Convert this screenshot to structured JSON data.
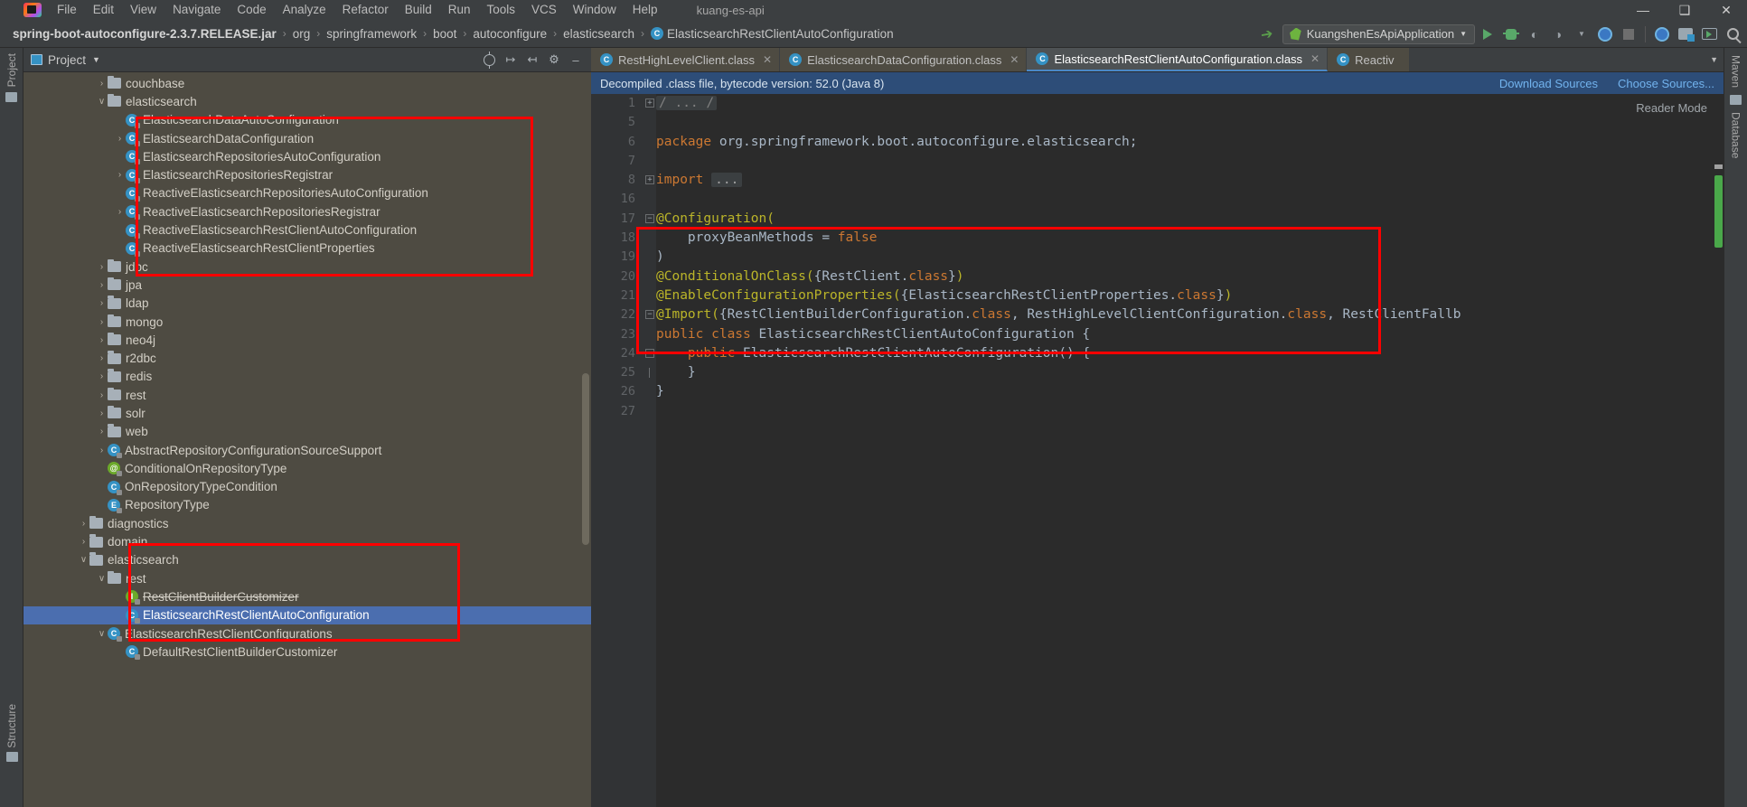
{
  "titlebar": {
    "menus": [
      "File",
      "Edit",
      "View",
      "Navigate",
      "Code",
      "Analyze",
      "Refactor",
      "Build",
      "Run",
      "Tools",
      "VCS",
      "Window",
      "Help"
    ],
    "project_name": "kuang-es-api",
    "window_buttons": [
      "—",
      "❑",
      "✕"
    ]
  },
  "navbar": {
    "breadcrumbs": [
      {
        "label": "spring-boot-autoconfigure-2.3.7.RELEASE.jar",
        "type": "jar"
      },
      {
        "label": "org",
        "type": "pkg"
      },
      {
        "label": "springframework",
        "type": "pkg"
      },
      {
        "label": "boot",
        "type": "pkg"
      },
      {
        "label": "autoconfigure",
        "type": "pkg"
      },
      {
        "label": "elasticsearch",
        "type": "pkg"
      },
      {
        "label": "ElasticsearchRestClientAutoConfiguration",
        "type": "class",
        "icon": "C"
      }
    ],
    "separator": "›",
    "run_config": "KuangshenEsApiApplication",
    "run_config_caret": "▼",
    "icons": [
      "hammer-icon",
      "run-icon",
      "debug-icon",
      "run-coverage-icon",
      "profiler-icon",
      "stop-icon",
      "updater-icon",
      "search-everywhere-icon"
    ]
  },
  "left_stripe": {
    "project_label": "Project",
    "structure_label": "Structure"
  },
  "right_stripe": {
    "maven_label": "Maven",
    "database_label": "Database"
  },
  "project_panel": {
    "title": "Project",
    "caret": "▼",
    "actions": [
      "locate-icon",
      "expand-all-icon",
      "collapse-all-icon",
      "settings-gear-icon",
      "hide-icon"
    ],
    "tree": [
      {
        "depth": 3,
        "arrow": "›",
        "kind": "folder",
        "label": "couchbase"
      },
      {
        "depth": 3,
        "arrow": "∨",
        "kind": "folder",
        "label": "elasticsearch"
      },
      {
        "depth": 4,
        "arrow": "",
        "kind": "class",
        "label": "ElasticsearchDataAutoConfiguration"
      },
      {
        "depth": 4,
        "arrow": "›",
        "kind": "class",
        "label": "ElasticsearchDataConfiguration"
      },
      {
        "depth": 4,
        "arrow": "",
        "kind": "class",
        "label": "ElasticsearchRepositoriesAutoConfiguration"
      },
      {
        "depth": 4,
        "arrow": "›",
        "kind": "class",
        "label": "ElasticsearchRepositoriesRegistrar"
      },
      {
        "depth": 4,
        "arrow": "",
        "kind": "class",
        "label": "ReactiveElasticsearchRepositoriesAutoConfiguration"
      },
      {
        "depth": 4,
        "arrow": "›",
        "kind": "class",
        "label": "ReactiveElasticsearchRepositoriesRegistrar"
      },
      {
        "depth": 4,
        "arrow": "",
        "kind": "class",
        "label": "ReactiveElasticsearchRestClientAutoConfiguration"
      },
      {
        "depth": 4,
        "arrow": "",
        "kind": "class",
        "label": "ReactiveElasticsearchRestClientProperties"
      },
      {
        "depth": 3,
        "arrow": "›",
        "kind": "folder",
        "label": "jdbc"
      },
      {
        "depth": 3,
        "arrow": "›",
        "kind": "folder",
        "label": "jpa"
      },
      {
        "depth": 3,
        "arrow": "›",
        "kind": "folder",
        "label": "ldap"
      },
      {
        "depth": 3,
        "arrow": "›",
        "kind": "folder",
        "label": "mongo"
      },
      {
        "depth": 3,
        "arrow": "›",
        "kind": "folder",
        "label": "neo4j"
      },
      {
        "depth": 3,
        "arrow": "›",
        "kind": "folder",
        "label": "r2dbc"
      },
      {
        "depth": 3,
        "arrow": "›",
        "kind": "folder",
        "label": "redis"
      },
      {
        "depth": 3,
        "arrow": "›",
        "kind": "folder",
        "label": "rest"
      },
      {
        "depth": 3,
        "arrow": "›",
        "kind": "folder",
        "label": "solr"
      },
      {
        "depth": 3,
        "arrow": "›",
        "kind": "folder",
        "label": "web"
      },
      {
        "depth": 3,
        "arrow": "›",
        "kind": "class",
        "label": "AbstractRepositoryConfigurationSourceSupport"
      },
      {
        "depth": 3,
        "arrow": "",
        "kind": "annotation",
        "label": "ConditionalOnRepositoryType"
      },
      {
        "depth": 3,
        "arrow": "",
        "kind": "class",
        "label": "OnRepositoryTypeCondition"
      },
      {
        "depth": 3,
        "arrow": "",
        "kind": "enum",
        "label": "RepositoryType"
      },
      {
        "depth": 2,
        "arrow": "›",
        "kind": "folder",
        "label": "diagnostics"
      },
      {
        "depth": 2,
        "arrow": "›",
        "kind": "folder",
        "label": "domain"
      },
      {
        "depth": 2,
        "arrow": "∨",
        "kind": "folder",
        "label": "elasticsearch"
      },
      {
        "depth": 3,
        "arrow": "∨",
        "kind": "folder",
        "label": "rest"
      },
      {
        "depth": 4,
        "arrow": "",
        "kind": "interface",
        "label": "RestClientBuilderCustomizer",
        "strike": true
      },
      {
        "depth": 4,
        "arrow": "",
        "kind": "class",
        "label": "ElasticsearchRestClientAutoConfiguration",
        "selected": true
      },
      {
        "depth": 3,
        "arrow": "∨",
        "kind": "class",
        "label": "ElasticsearchRestClientConfigurations"
      },
      {
        "depth": 4,
        "arrow": "",
        "kind": "class",
        "label": "DefaultRestClientBuilderCustomizer"
      }
    ]
  },
  "editor": {
    "tabs": [
      {
        "label": "RestHighLevelClient.class",
        "active": false,
        "close": "✕"
      },
      {
        "label": "ElasticsearchDataConfiguration.class",
        "active": false,
        "close": "✕"
      },
      {
        "label": "ElasticsearchRestClientAutoConfiguration.class",
        "active": true,
        "close": "✕"
      },
      {
        "label": "Reactiv",
        "active": false,
        "close": ""
      }
    ],
    "tabs_overflow_caret": "▼",
    "notification": "Decompiled .class file, bytecode version: 52.0 (Java 8)",
    "notification_links": [
      "Download Sources",
      "Choose Sources..."
    ],
    "reader_mode": "Reader Mode",
    "gutter_numbers": [
      "1",
      "5",
      "6",
      "7",
      "8",
      "16",
      "17",
      "18",
      "19",
      "20",
      "21",
      "22",
      "23",
      "24",
      "25",
      "26",
      "27"
    ],
    "code_lines": [
      {
        "num": "1",
        "fold": "plus",
        "tokens": [
          {
            "t": "/ ... /",
            "c": "cmtfold"
          }
        ]
      },
      {
        "num": "5",
        "fold": "",
        "tokens": []
      },
      {
        "num": "6",
        "fold": "",
        "tokens": [
          {
            "t": "package",
            "c": "kw"
          },
          {
            "t": " org.springframework.boot.autoconfigure.elasticsearch;",
            "c": "cls"
          }
        ]
      },
      {
        "num": "7",
        "fold": "",
        "tokens": []
      },
      {
        "num": "8",
        "fold": "plus",
        "tokens": [
          {
            "t": "import",
            "c": "kw"
          },
          {
            "t": " ",
            "c": "cls"
          },
          {
            "t": "...",
            "c": "ellip"
          }
        ]
      },
      {
        "num": "16",
        "fold": "",
        "tokens": []
      },
      {
        "num": "17",
        "fold": "minus",
        "tokens": [
          {
            "t": "@Configuration(",
            "c": "ann"
          }
        ]
      },
      {
        "num": "18",
        "fold": "",
        "tokens": [
          {
            "t": "    proxyBeanMethods = ",
            "c": "cls"
          },
          {
            "t": "false",
            "c": "kw"
          }
        ]
      },
      {
        "num": "19",
        "fold": "",
        "tokens": [
          {
            "t": ")",
            "c": "cls"
          }
        ]
      },
      {
        "num": "20",
        "fold": "",
        "tokens": [
          {
            "t": "@ConditionalOnClass(",
            "c": "ann"
          },
          {
            "t": "{RestClient.",
            "c": "cls"
          },
          {
            "t": "class",
            "c": "kw"
          },
          {
            "t": "}",
            "c": "cls"
          },
          {
            "t": ")",
            "c": "ann"
          }
        ]
      },
      {
        "num": "21",
        "fold": "",
        "tokens": [
          {
            "t": "@EnableConfigurationProperties(",
            "c": "ann"
          },
          {
            "t": "{ElasticsearchRestClientProperties.",
            "c": "cls"
          },
          {
            "t": "class",
            "c": "kw"
          },
          {
            "t": "}",
            "c": "cls"
          },
          {
            "t": ")",
            "c": "ann"
          }
        ]
      },
      {
        "num": "22",
        "fold": "minus",
        "tokens": [
          {
            "t": "@Import(",
            "c": "ann"
          },
          {
            "t": "{RestClientBuilderConfiguration.",
            "c": "cls"
          },
          {
            "t": "class",
            "c": "kw"
          },
          {
            "t": ", RestHighLevelClientConfiguration.",
            "c": "cls"
          },
          {
            "t": "class",
            "c": "kw"
          },
          {
            "t": ", RestClientFallb",
            "c": "cls"
          }
        ]
      },
      {
        "num": "23",
        "fold": "",
        "tokens": [
          {
            "t": "public class",
            "c": "kw"
          },
          {
            "t": " ElasticsearchRestClientAutoConfiguration {",
            "c": "cls"
          }
        ]
      },
      {
        "num": "24",
        "fold": "minus",
        "tokens": [
          {
            "t": "    public",
            "c": "kw"
          },
          {
            "t": " ElasticsearchRestClientAutoConfiguration() {",
            "c": "cls"
          }
        ]
      },
      {
        "num": "25",
        "fold": "line",
        "tokens": [
          {
            "t": "    }",
            "c": "cls"
          }
        ]
      },
      {
        "num": "26",
        "fold": "",
        "tokens": [
          {
            "t": "}",
            "c": "cls"
          }
        ]
      },
      {
        "num": "27",
        "fold": "",
        "tokens": []
      }
    ]
  },
  "colors": {
    "accent_red": "#fe0000",
    "selection_blue": "#4b6eaf",
    "notification_blue": "#2d4d78",
    "panel_bg": "#4e4b42",
    "editor_bg": "#2b2b2b",
    "chrome_bg": "#3c3f41"
  }
}
